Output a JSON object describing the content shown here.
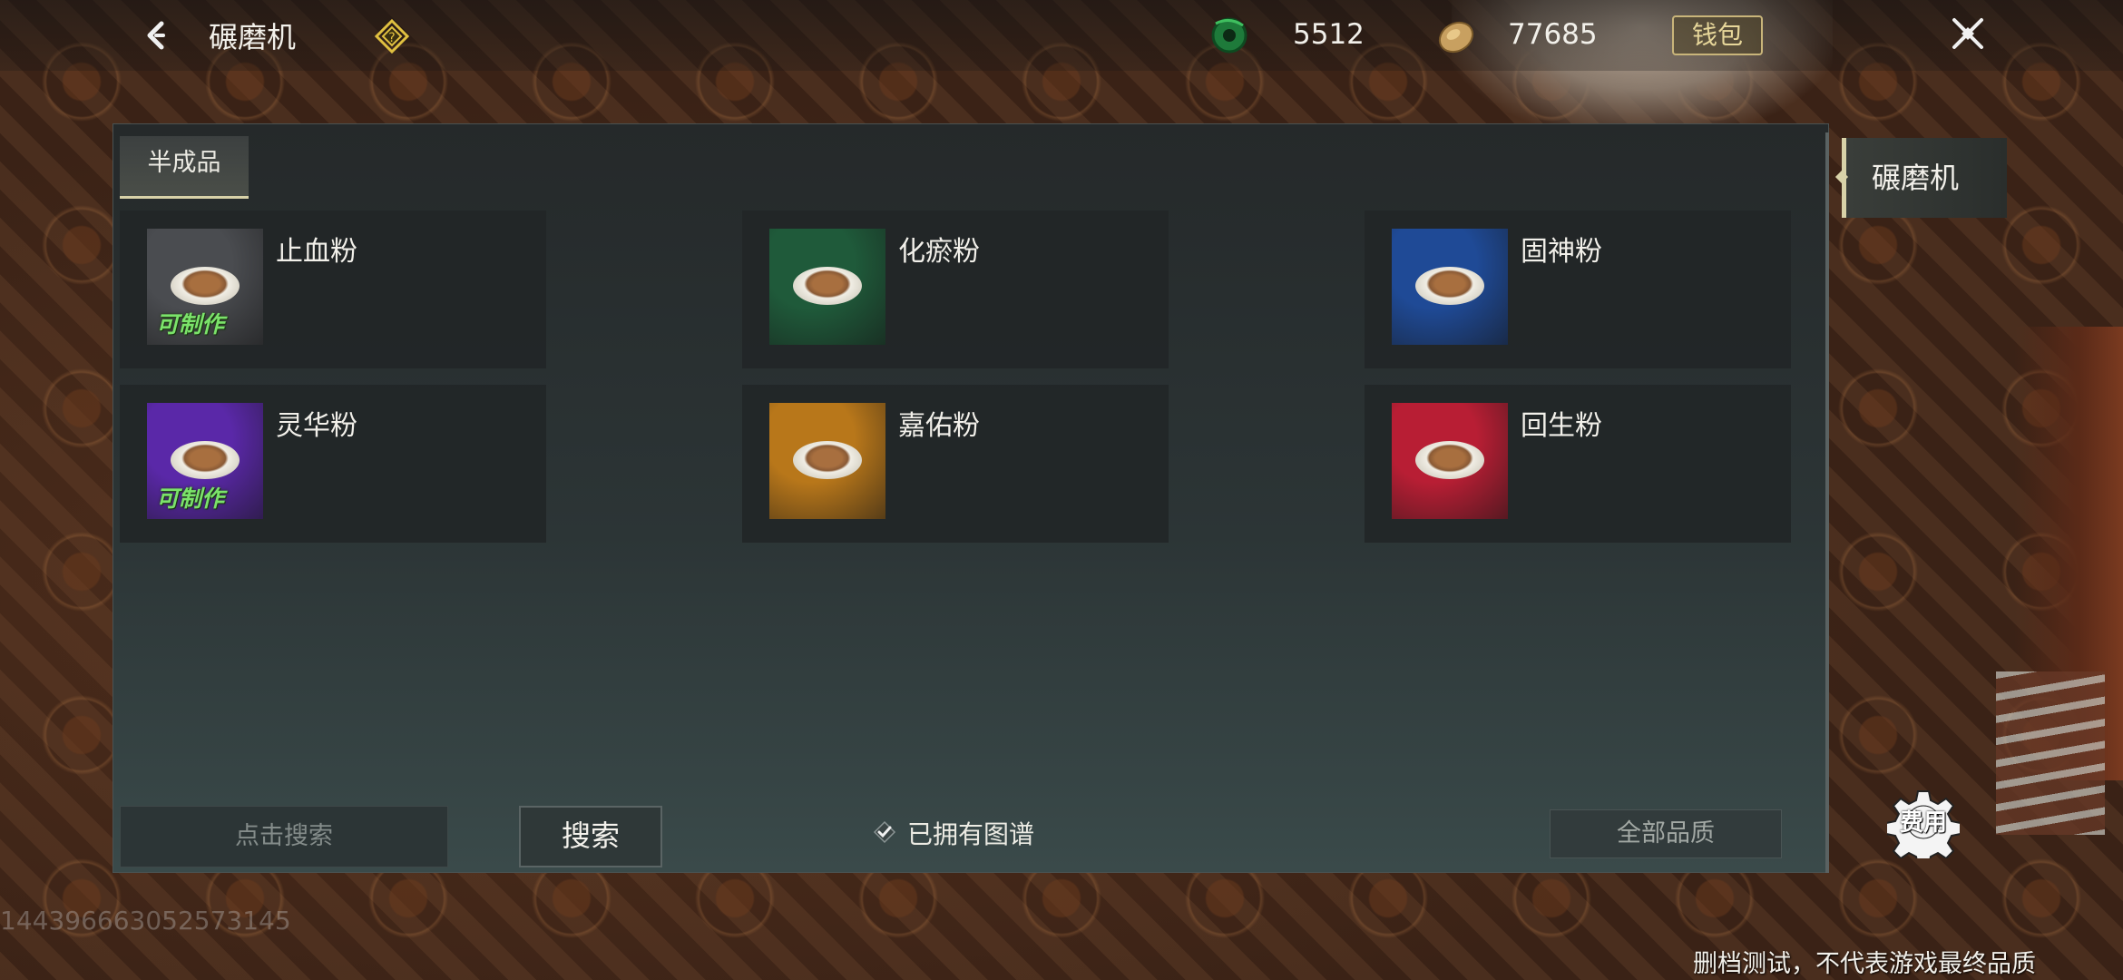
{
  "header": {
    "title": "碾磨机",
    "currency1_value": "5512",
    "currency2_value": "77685",
    "wallet_label": "钱包"
  },
  "tabs": [
    {
      "label": "半成品",
      "active": true
    }
  ],
  "recipes": [
    {
      "name": "止血粉",
      "color": "#4a4c50",
      "craftable": true
    },
    {
      "name": "化瘀粉",
      "color": "#1f5a3a",
      "craftable": false
    },
    {
      "name": "固神粉",
      "color": "#1f4a96",
      "craftable": false
    },
    {
      "name": "灵华粉",
      "color": "#5a28a8",
      "craftable": true
    },
    {
      "name": "嘉佑粉",
      "color": "#b8771a",
      "craftable": false
    },
    {
      "name": "回生粉",
      "color": "#b81e34",
      "craftable": false
    }
  ],
  "craftable_label": "可制作",
  "search": {
    "placeholder": "点击搜索",
    "button_label": "搜索"
  },
  "owned_filter": {
    "label": "已拥有图谱",
    "checked": true
  },
  "quality_filter": {
    "selected": "全部品质"
  },
  "sidebar": {
    "items": [
      {
        "label": "碾磨机",
        "active": true
      }
    ],
    "gear_label": "费用"
  },
  "footer": {
    "uid": "1443966630525731​45",
    "disclaimer": "删档测试，不代表游戏最终品质"
  }
}
